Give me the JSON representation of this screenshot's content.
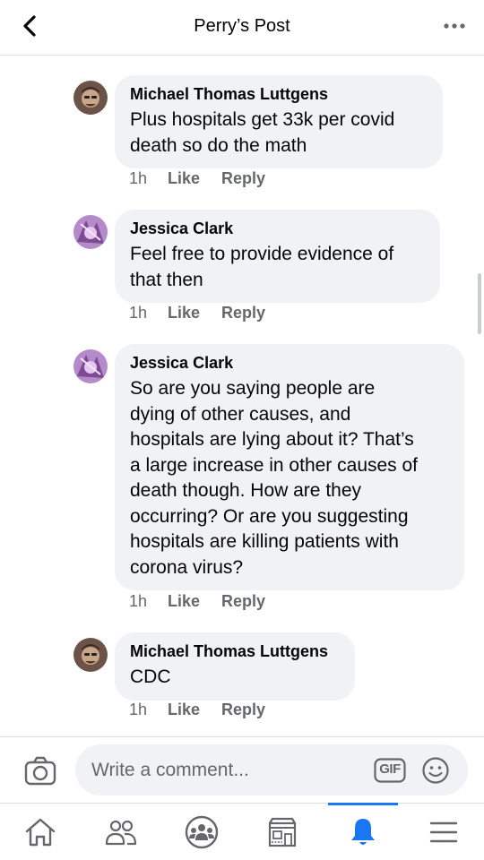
{
  "header": {
    "title": "Perry’s Post",
    "back_icon": "chevron-left-icon",
    "more_icon": "more-horizontal-icon"
  },
  "comments": [
    {
      "author": "Michael Thomas Luttgens",
      "text": "Plus hospitals get 33k per covid\ndeath so do the math",
      "time": "1h",
      "like": "Like",
      "reply": "Reply"
    },
    {
      "author": "Jessica Clark",
      "text": "Feel free to provide evidence of\nthat then",
      "time": "1h",
      "like": "Like",
      "reply": "Reply"
    },
    {
      "author": "Jessica Clark",
      "text": "So are you saying people are\ndying of other causes, and\nhospitals are lying about it? That’s\na large increase in other causes of\ndeath though. How are they\noccurring? Or are you suggesting\nhospitals are killing patients with\ncorona virus?",
      "time": "1h",
      "like": "Like",
      "reply": "Reply"
    },
    {
      "author": "Michael Thomas Luttgens",
      "text": "CDC",
      "time": "1h",
      "like": "Like",
      "reply": "Reply"
    }
  ],
  "composer": {
    "placeholder": "Write a comment...",
    "gif_label": "GIF"
  },
  "tabbar": {
    "items": [
      "home-icon",
      "friends-icon",
      "groups-icon",
      "marketplace-icon",
      "notifications-icon",
      "menu-icon"
    ],
    "active": "notifications-icon",
    "accent": "#1877f2"
  }
}
